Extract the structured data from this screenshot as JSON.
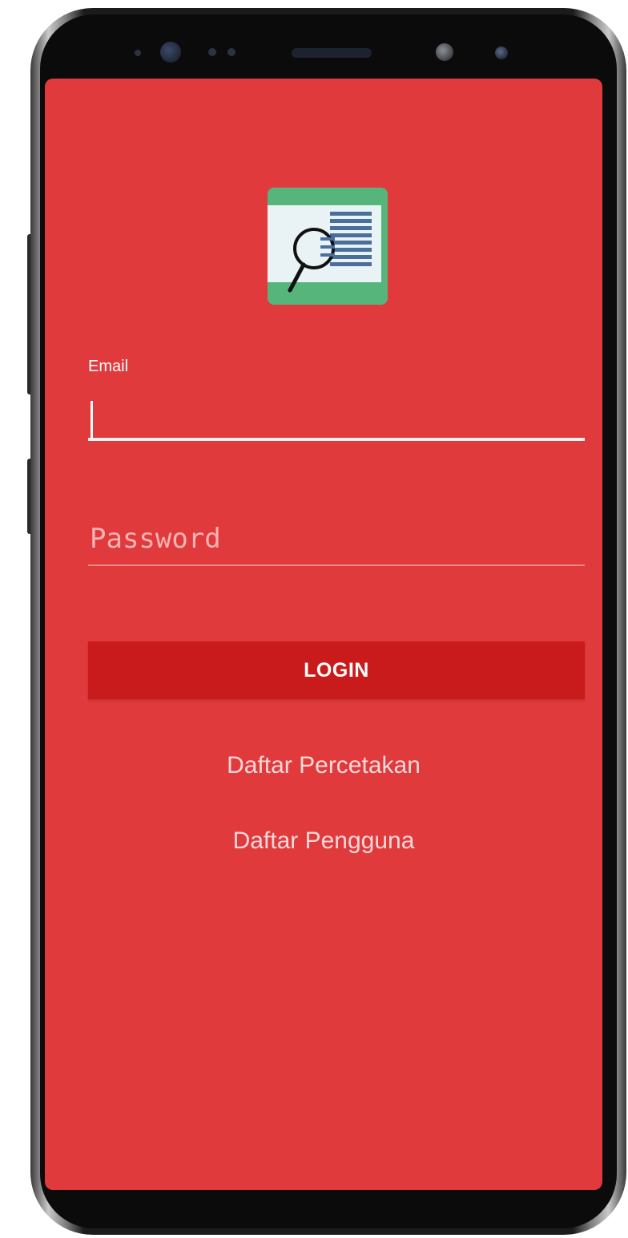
{
  "app": {
    "logo_icon": "document-search-icon",
    "accent_color": "#e03a3c",
    "button_color": "#c91b1b"
  },
  "form": {
    "email_label": "Email",
    "email_value": "",
    "password_placeholder": "Password",
    "password_value": ""
  },
  "actions": {
    "login_label": "LOGIN",
    "link_printing": "Daftar Percetakan",
    "link_user": "Daftar Pengguna"
  }
}
